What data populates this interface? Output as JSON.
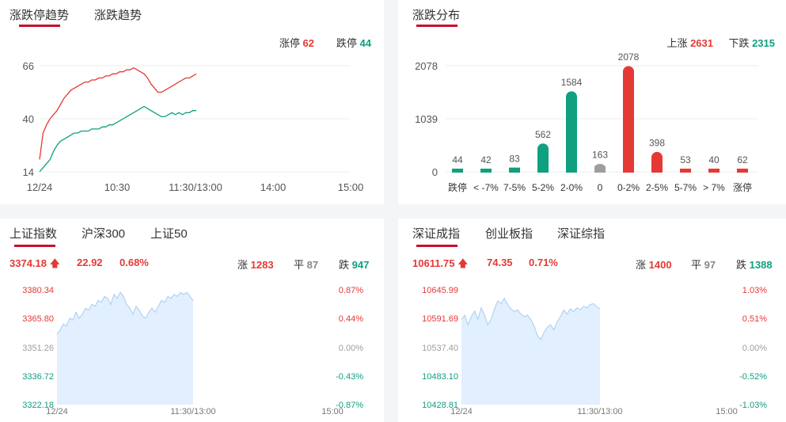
{
  "colors": {
    "up": "#e53935",
    "down": "#0fa07f",
    "flat": "#9e9e9e",
    "accent": "#c8102e",
    "area": "#e1efff",
    "areaLine": "#a8cdf0"
  },
  "p1": {
    "tabs": [
      "涨跌停趋势",
      "涨跌趋势"
    ],
    "limit_up_label": "涨停",
    "limit_up": "62",
    "limit_down_label": "跌停",
    "limit_down": "44"
  },
  "p2": {
    "tabs": [
      "涨跌分布"
    ],
    "up_label": "上涨",
    "up": "2631",
    "down_label": "下跌",
    "down": "2315"
  },
  "p3": {
    "tabs": [
      "上证指数",
      "沪深300",
      "上证50"
    ],
    "price": "3374.18",
    "change": "22.92",
    "pct": "0.68%",
    "up_label": "涨",
    "up": "1283",
    "flat_label": "平",
    "flat": "87",
    "down_label": "跌",
    "down": "947"
  },
  "p4": {
    "tabs": [
      "深证成指",
      "创业板指",
      "深证综指"
    ],
    "price": "10611.75",
    "change": "74.35",
    "pct": "0.71%",
    "up_label": "涨",
    "up": "1400",
    "flat_label": "平",
    "flat": "97",
    "down_label": "跌",
    "down": "1388"
  },
  "chart_data": [
    {
      "type": "line",
      "title": "",
      "x_ticks": [
        "12/24",
        "10:30",
        "11:30/13:00",
        "14:00",
        "15:00"
      ],
      "y_ticks": [
        14,
        40,
        66
      ],
      "ylim": [
        14,
        66
      ],
      "grid": true,
      "series": [
        {
          "name": "涨停",
          "color": "#e53935",
          "values": [
            20,
            33,
            37,
            40,
            42,
            44,
            47,
            50,
            52,
            54,
            55,
            56,
            57,
            58,
            58,
            59,
            59,
            60,
            60,
            61,
            61,
            62,
            62,
            63,
            63,
            64,
            64,
            65,
            64,
            63,
            62,
            60,
            57,
            55,
            53,
            53,
            54,
            55,
            56,
            57,
            58,
            59,
            60,
            60,
            61,
            62
          ]
        },
        {
          "name": "跌停",
          "color": "#0fa07f",
          "values": [
            14,
            16,
            18,
            20,
            24,
            27,
            29,
            30,
            31,
            32,
            33,
            33,
            34,
            34,
            34,
            35,
            35,
            35,
            36,
            36,
            37,
            37,
            38,
            39,
            40,
            41,
            42,
            43,
            44,
            45,
            46,
            45,
            44,
            43,
            42,
            41,
            41,
            42,
            43,
            42,
            43,
            42,
            43,
            43,
            44,
            44
          ]
        }
      ]
    },
    {
      "type": "bar",
      "title": "",
      "categories": [
        "跌停",
        "< -7%",
        "7-5%",
        "5-2%",
        "2-0%",
        "0",
        "0-2%",
        "2-5%",
        "5-7%",
        "> 7%",
        "涨停"
      ],
      "values": [
        44,
        42,
        83,
        562,
        1584,
        163,
        2078,
        398,
        53,
        40,
        62
      ],
      "bar_colors": [
        "down",
        "down",
        "down",
        "down",
        "down",
        "flat",
        "up",
        "up",
        "up",
        "up",
        "up"
      ],
      "y_ticks": [
        0,
        1039,
        2078
      ],
      "ylim": [
        0,
        2078
      ],
      "grid": true
    },
    {
      "type": "area",
      "title": "",
      "x_ticks": [
        "12/24",
        "11:30/13:00",
        "15:00"
      ],
      "y_ticks": [
        "3380.34",
        "3365.80",
        "3351.26",
        "3336.72",
        "3322.18"
      ],
      "y_tick_colors": [
        "up",
        "up",
        "flat",
        "down",
        "down"
      ],
      "pct_ticks": [
        "0.87%",
        "0.44%",
        "0.00%",
        "-0.43%",
        "-0.87%"
      ],
      "ylim": [
        3322.18,
        3380.34
      ],
      "values": [
        3358,
        3360,
        3363,
        3362,
        3366,
        3365,
        3369,
        3366,
        3368,
        3371,
        3370,
        3373,
        3372,
        3375,
        3374,
        3377,
        3376,
        3373,
        3378,
        3376,
        3379,
        3377,
        3373,
        3371,
        3368,
        3372,
        3370,
        3367,
        3366,
        3369,
        3371,
        3369,
        3372,
        3375,
        3374,
        3377,
        3376,
        3378,
        3377,
        3379,
        3378,
        3379,
        3377,
        3375
      ]
    },
    {
      "type": "area",
      "title": "",
      "x_ticks": [
        "12/24",
        "11:30/13:00",
        "15:00"
      ],
      "y_ticks": [
        "10645.99",
        "10591.69",
        "10537.40",
        "10483.10",
        "10428.81"
      ],
      "y_tick_colors": [
        "up",
        "up",
        "flat",
        "down",
        "down"
      ],
      "pct_ticks": [
        "1.03%",
        "0.51%",
        "0.00%",
        "-0.52%",
        "-1.03%"
      ],
      "ylim": [
        10428.81,
        10645.99
      ],
      "values": [
        10590,
        10598,
        10580,
        10595,
        10606,
        10590,
        10612,
        10598,
        10580,
        10590,
        10610,
        10625,
        10620,
        10630,
        10618,
        10610,
        10605,
        10608,
        10600,
        10595,
        10598,
        10590,
        10578,
        10560,
        10552,
        10565,
        10575,
        10580,
        10570,
        10585,
        10595,
        10608,
        10600,
        10610,
        10605,
        10612,
        10608,
        10615,
        10612,
        10618,
        10620,
        10614,
        10610
      ]
    }
  ]
}
